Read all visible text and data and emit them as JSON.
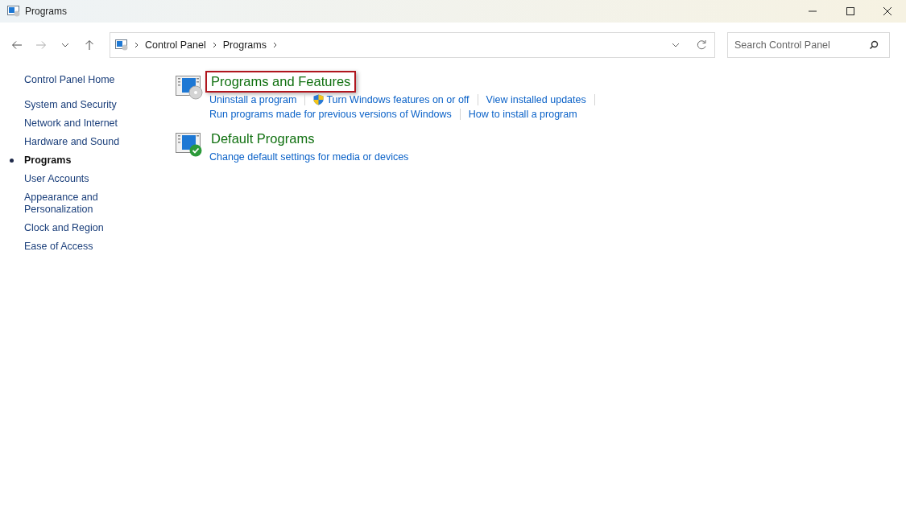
{
  "window": {
    "title": "Programs"
  },
  "address_bar": {
    "breadcrumbs": [
      "Control Panel",
      "Programs"
    ]
  },
  "search": {
    "placeholder": "Search Control Panel"
  },
  "sidebar": {
    "home": "Control Panel Home",
    "items": [
      {
        "label": "System and Security",
        "selected": false
      },
      {
        "label": "Network and Internet",
        "selected": false
      },
      {
        "label": "Hardware and Sound",
        "selected": false
      },
      {
        "label": "Programs",
        "selected": true
      },
      {
        "label": "User Accounts",
        "selected": false
      },
      {
        "label": "Appearance and Personalization",
        "selected": false
      },
      {
        "label": "Clock and Region",
        "selected": false
      },
      {
        "label": "Ease of Access",
        "selected": false
      }
    ]
  },
  "categories": [
    {
      "kind": "features",
      "title": "Programs and Features",
      "highlighted": true,
      "link_rows": [
        [
          {
            "label": "Uninstall a program",
            "kind": "plain",
            "separator_after": true
          },
          {
            "label": "Turn Windows features on or off",
            "kind": "shield",
            "separator_after": true
          },
          {
            "label": "View installed updates",
            "kind": "plain",
            "separator_after": true
          }
        ],
        [
          {
            "label": "Run programs made for previous versions of Windows",
            "kind": "plain",
            "separator_after": true
          },
          {
            "label": "How to install a program",
            "kind": "plain",
            "separator_after": false
          }
        ]
      ]
    },
    {
      "kind": "defaults",
      "title": "Default Programs",
      "highlighted": false,
      "link_rows": [
        [
          {
            "label": "Change default settings for media or devices",
            "kind": "plain",
            "separator_after": false
          }
        ]
      ]
    }
  ]
}
